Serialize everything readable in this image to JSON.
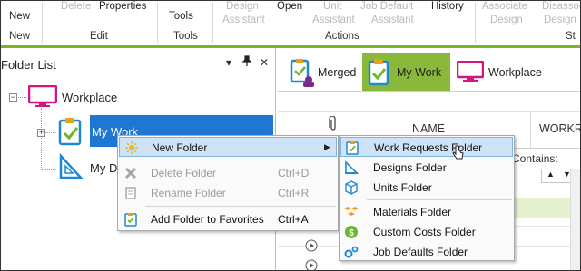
{
  "ribbon": {
    "new_top": "New",
    "delete": "Delete",
    "properties": "Properties",
    "tools_top": "Tools",
    "design_assistant_1": "Design",
    "design_assistant_2": "Assistant",
    "open": "Open",
    "unit_assistant_1": "Unit",
    "unit_assistant_2": "Assistant",
    "job_default_1": "Job Default",
    "job_default_2": "Assistant",
    "history": "History",
    "associate_1": "Associate",
    "associate_2": "Design",
    "disassociate_1": "Disassoci",
    "disassociate_2": "Design",
    "groups": {
      "new": "New",
      "edit": "Edit",
      "tools": "Tools",
      "actions": "Actions",
      "st": "St"
    }
  },
  "folder_list": {
    "title": "Folder List",
    "dropdown": "▾",
    "pin": "📌",
    "close": "✕",
    "nodes": {
      "workplace": "Workplace",
      "my_work": "My Work",
      "my_designs": "My D"
    }
  },
  "tabs": [
    {
      "label": "Merged"
    },
    {
      "label": "My Work"
    },
    {
      "label": "Workplace"
    }
  ],
  "grid": {
    "col_name": "NAME",
    "col_workreq": "WORKRE",
    "filter_contains": "Contains:"
  },
  "context_menu": {
    "items": [
      {
        "label": "New Folder",
        "shortcut": ""
      },
      {
        "label": "Delete Folder",
        "shortcut": "Ctrl+D"
      },
      {
        "label": "Rename Folder",
        "shortcut": "Ctrl+R"
      },
      {
        "label": "Add Folder to Favorites",
        "shortcut": "Ctrl+A"
      }
    ]
  },
  "submenu": {
    "items": [
      {
        "label": "Work Requests Folder"
      },
      {
        "label": "Designs Folder"
      },
      {
        "label": "Units Folder"
      },
      {
        "label": "Materials Folder"
      },
      {
        "label": "Custom Costs Folder"
      },
      {
        "label": "Job Defaults Folder"
      }
    ]
  },
  "colors": {
    "accent_green": "#7ab528",
    "selection_blue": "#1e78d2",
    "menu_highlight": "#cfe3f7"
  }
}
